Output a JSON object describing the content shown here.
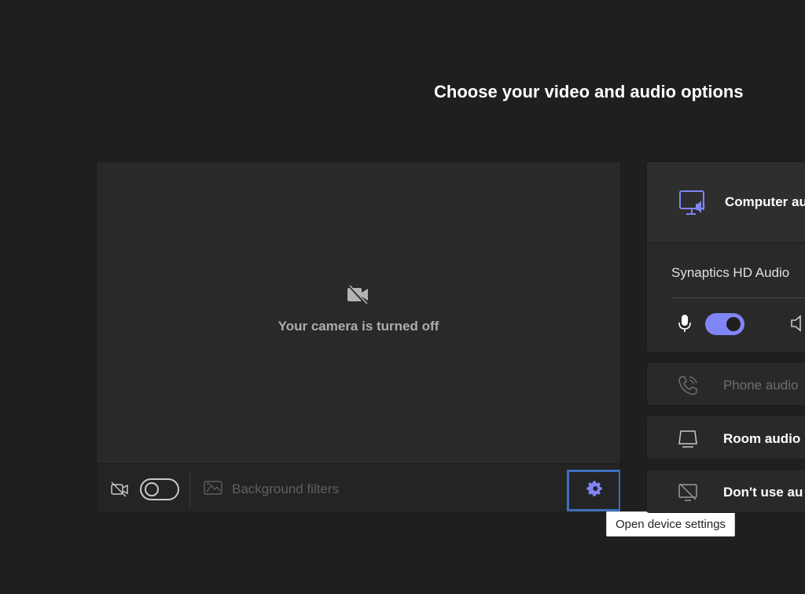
{
  "header": {
    "title": "Choose your video and audio options"
  },
  "video": {
    "camera_off_text": "Your camera is turned off",
    "background_filters_label": "Background filters",
    "camera_toggle_state": "off"
  },
  "tooltip": {
    "text": "Open device settings"
  },
  "audio": {
    "computer_audio_label": "Computer au",
    "device_name": "Synaptics HD Audio",
    "mic_toggle_state": "on",
    "options": [
      {
        "label": "Phone audio"
      },
      {
        "label": "Room audio"
      },
      {
        "label": "Don't use au"
      }
    ]
  },
  "colors": {
    "accent": "#7f85f5",
    "focus_outline": "#3d6fbf",
    "background": "#1f1f1f",
    "panel": "#292929"
  }
}
